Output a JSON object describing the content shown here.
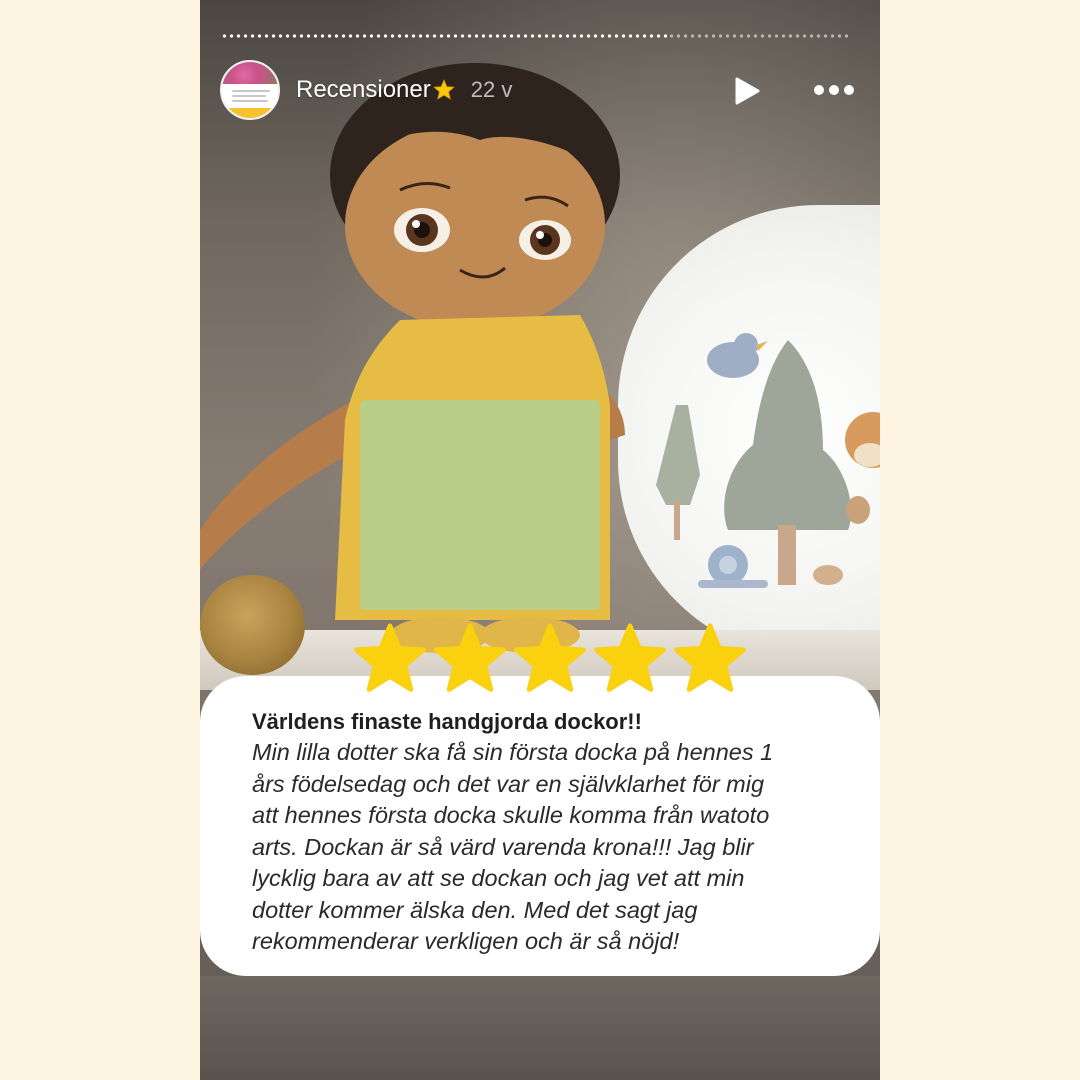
{
  "story": {
    "account_name": "Recensioner",
    "age_label": "22 v",
    "progress_fraction": 0.71
  },
  "icons": {
    "avatar": "avatar-thumbnail",
    "badge": "star-emoji-icon",
    "play": "play-icon",
    "more": "more-icon"
  },
  "review": {
    "rating": 5,
    "rating_max": 5,
    "title": "Världens finaste handgjorda dockor!!",
    "lines": [
      "Min lilla dotter ska få sin första docka på hennes 1",
      "års födelsedag och det var en självklarhet för mig",
      "att hennes första docka skulle komma från watoto",
      "arts. Dockan är så värd varenda krona!!! Jag blir",
      "lycklig bara av att se dockan och jag vet att min",
      "dotter kommer älska den. Med det sagt jag",
      "rekommenderar verkligen och är så nöjd!"
    ]
  },
  "colors": {
    "page_background": "#fdf5e2",
    "star": "#f9d10f",
    "card": "#ffffff"
  }
}
